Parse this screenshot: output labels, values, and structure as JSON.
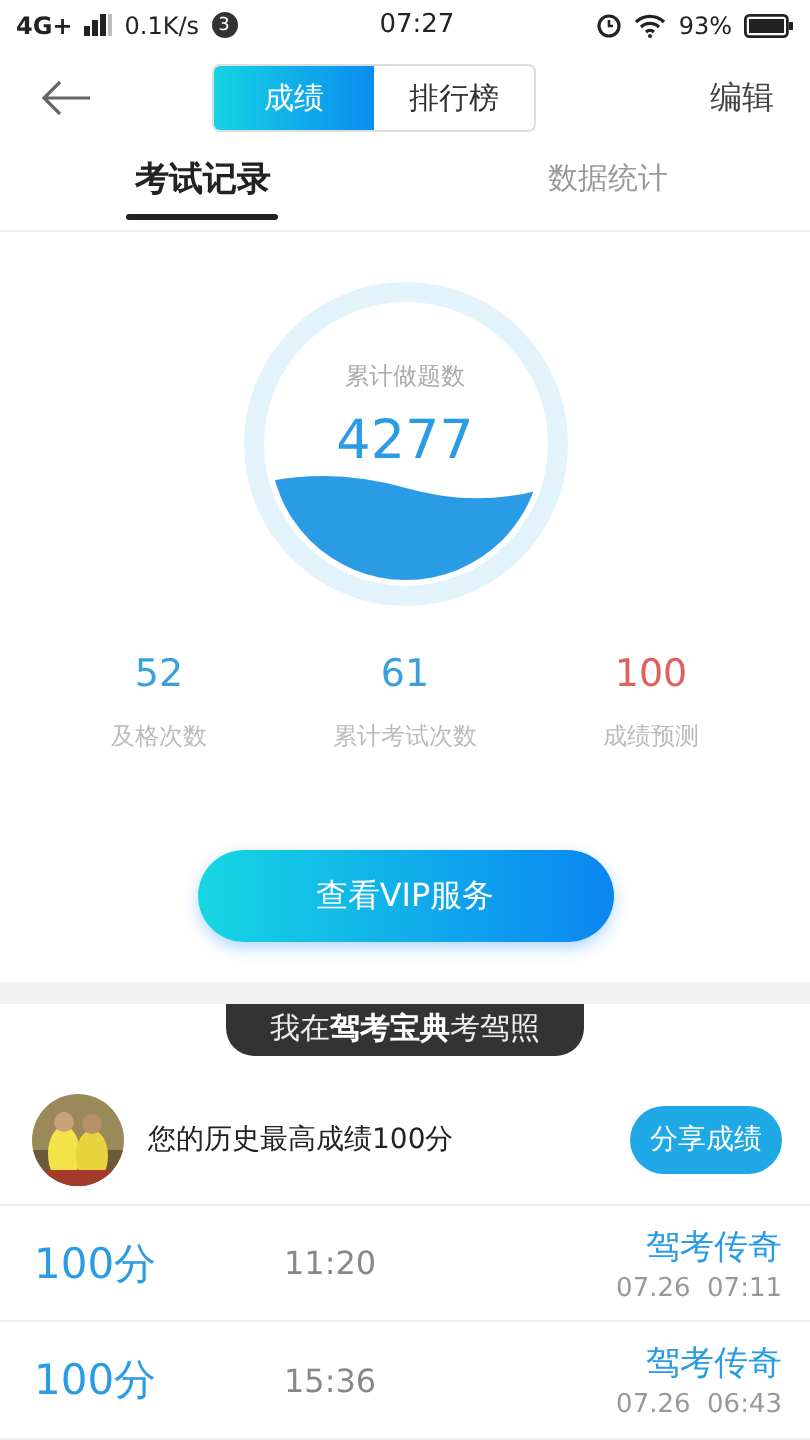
{
  "status_bar": {
    "network": "4G+",
    "speed": "0.1K/s",
    "notification_count": "3",
    "time": "07:27",
    "battery": "93%"
  },
  "header": {
    "segments": [
      {
        "label": "成绩",
        "selected": true
      },
      {
        "label": "排行榜",
        "selected": false
      }
    ],
    "edit": "编辑"
  },
  "tabs": [
    {
      "label": "考试记录",
      "selected": true
    },
    {
      "label": "数据统计",
      "selected": false
    }
  ],
  "gauge": {
    "label": "累计做题数",
    "value": "4277"
  },
  "stats": [
    {
      "value": "52",
      "label": "及格次数",
      "kind": "normal"
    },
    {
      "value": "61",
      "label": "累计考试次数",
      "kind": "normal"
    },
    {
      "value": "100",
      "label": "成绩预测",
      "kind": "prediction"
    }
  ],
  "vip_button": "查看VIP服务",
  "banner": "我在**驾考宝典**考驾照",
  "best": {
    "text": "您的历史最高成绩100分",
    "share": "分享成绩"
  },
  "records": [
    {
      "score": "100分",
      "duration": "11:20",
      "title": "驾考传奇",
      "date": "07.26  07:11"
    },
    {
      "score": "100分",
      "duration": "15:36",
      "title": "驾考传奇",
      "date": "07.26  06:43"
    }
  ]
}
